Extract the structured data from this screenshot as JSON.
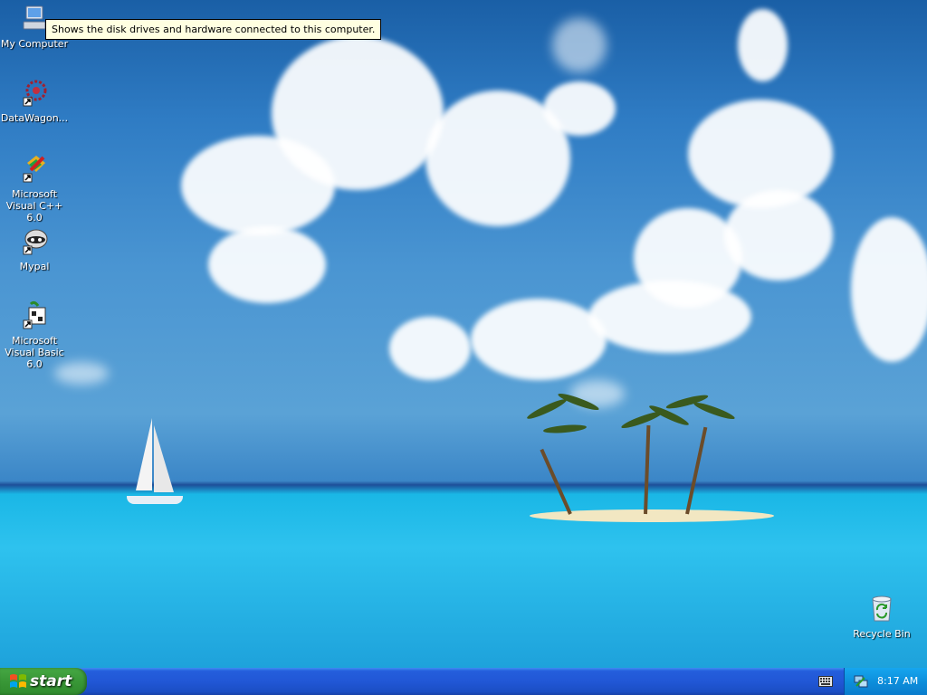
{
  "desktop": {
    "tooltip": "Shows the disk drives and hardware connected to this computer.",
    "icons": [
      {
        "label": "My Computer",
        "icon": "computer-icon"
      },
      {
        "label": "DataWagon...",
        "icon": "network-icon"
      },
      {
        "label": "Microsoft Visual C++ 6.0",
        "icon": "visual-cpp-icon"
      },
      {
        "label": "Mypal",
        "icon": "mypal-icon"
      },
      {
        "label": "Microsoft Visual Basic 6.0",
        "icon": "visual-basic-icon"
      },
      {
        "label": "Recycle Bin",
        "icon": "recycle-bin-icon"
      }
    ]
  },
  "taskbar": {
    "start_label": "start",
    "tray": {
      "keyboard_icon": "keyboard-icon",
      "network_icon": "network-tray-icon",
      "clock": "8:17 AM"
    }
  },
  "colors": {
    "taskbar_blue": "#245edc",
    "start_green": "#3b9a39",
    "tray_blue": "#0d8fdc",
    "tooltip_bg": "#ffffe1"
  }
}
